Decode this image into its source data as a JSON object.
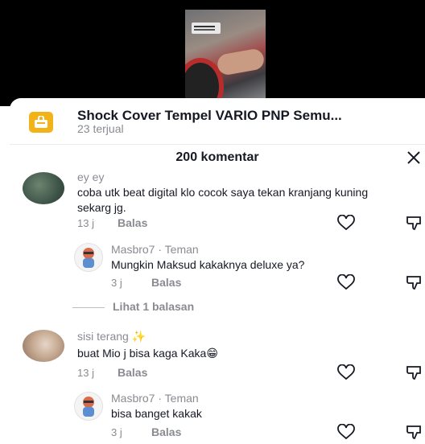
{
  "product": {
    "title": "Shock Cover Tempel VARIO PNP Semu...",
    "sold": "23 terjual",
    "icon": "shopping-bag-icon"
  },
  "comments_header": {
    "count_label": "200 komentar",
    "close_icon": "close-icon"
  },
  "comments": [
    {
      "name": "ey ey",
      "text": "coba utk beat digital klo cocok saya tekan kranjang kuning sekarg jg.",
      "time": "13 j",
      "reply_label": "Balas"
    },
    {
      "name": "Masbro7 · Teman",
      "text": "Mungkin Maksud kakaknya deluxe ya?",
      "time": "3 j",
      "reply_label": "Balas"
    },
    {
      "view_replies": "Lihat 1 balasan"
    },
    {
      "name": "sisi terang",
      "name_emoji": "✨",
      "text": "buat Mio j bisa kaga Kaka",
      "text_emoji": "😁",
      "time": "13 j",
      "reply_label": "Balas"
    },
    {
      "name": "Masbro7 · Teman",
      "text": "bisa banget kakak",
      "time": "3 j",
      "reply_label": "Balas"
    }
  ]
}
